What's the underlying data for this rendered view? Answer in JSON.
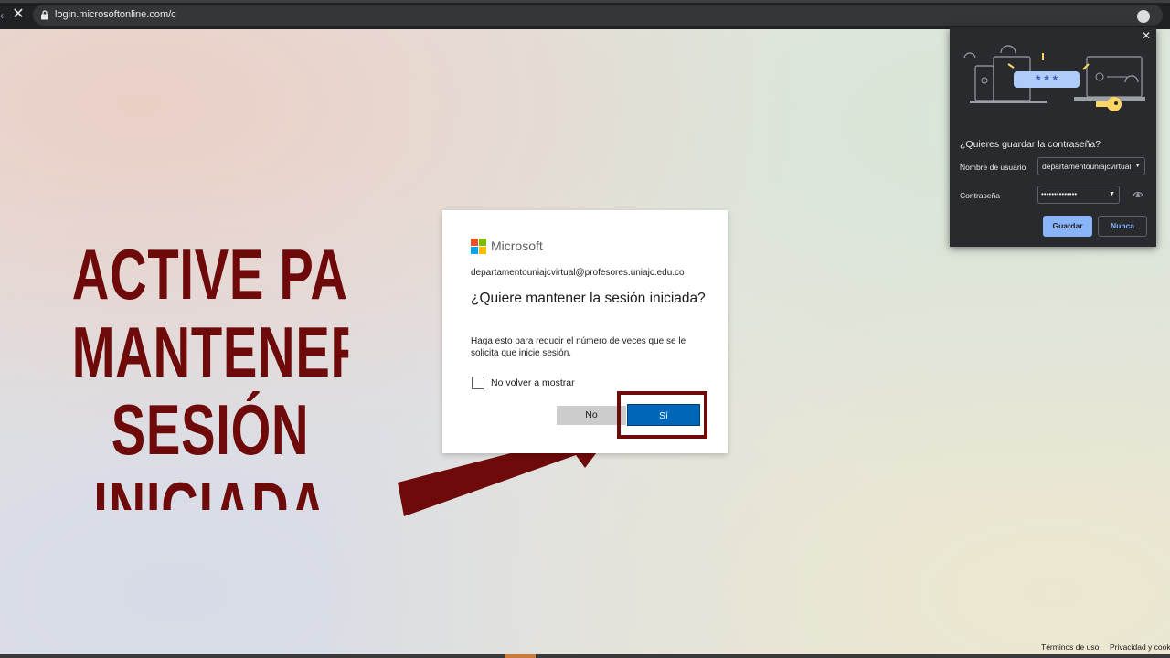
{
  "browser": {
    "url": "login.microsoftonline.com/c",
    "icons": {
      "stop": "close-icon",
      "lock": "lock-icon",
      "star": "star-icon"
    }
  },
  "overlay": {
    "lines": [
      "ACTIVE PARA",
      "MANTENER LA",
      "SESIÓN",
      "INICIADA"
    ],
    "color": "#6e0a0a"
  },
  "dialog": {
    "brand": "Microsoft",
    "email": "departamentouniajcvirtual@profesores.uniajc.edu.co",
    "title": "¿Quiere mantener la sesión iniciada?",
    "description": "Haga esto para reducir el número de veces que se le solicita que inicie sesión.",
    "checkbox_label": "No volver a mostrar",
    "no_label": "No",
    "yes_label": "Sí",
    "accent": "#0067b8"
  },
  "password_popup": {
    "title": "¿Quieres guardar la contraseña?",
    "username_label": "Nombre de usuario",
    "username_value": "departamentouniajcvirtual",
    "password_label": "Contraseña",
    "password_value": "••••••••••••••",
    "save_label": "Guardar",
    "never_label": "Nunca",
    "illustration_text": "* * *"
  },
  "footer": {
    "terms": "Términos de uso",
    "privacy": "Privacidad y cookies"
  }
}
